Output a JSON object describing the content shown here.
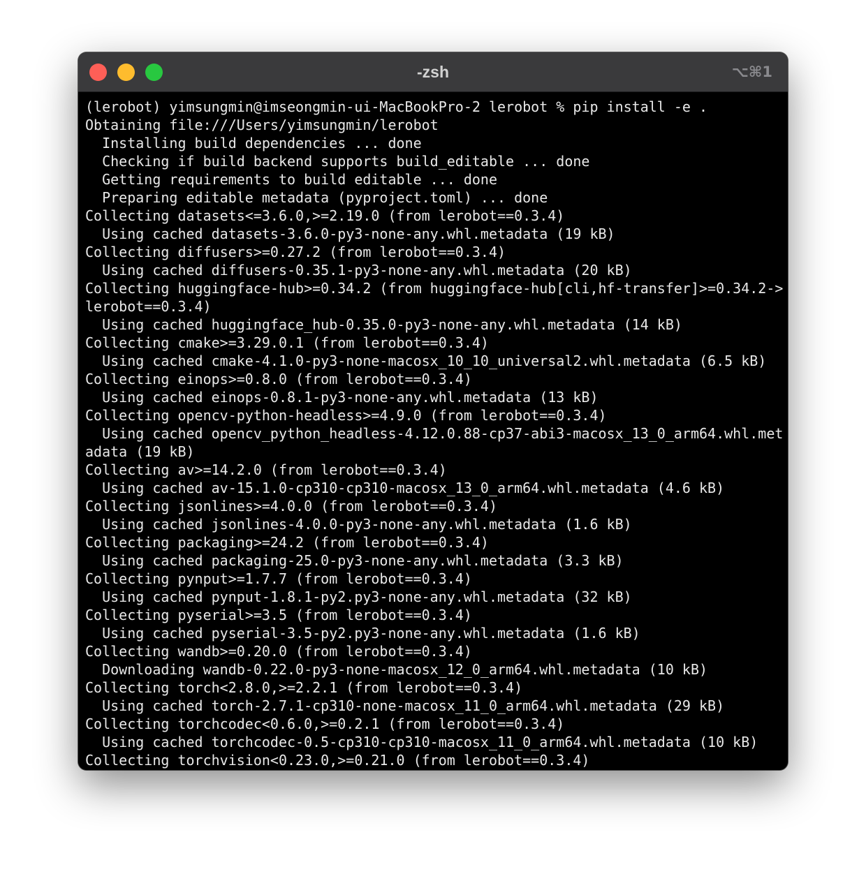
{
  "window": {
    "title": "-zsh",
    "shortcut": "⌥⌘1"
  },
  "terminal": {
    "lines": [
      "(lerobot) yimsungmin@imseongmin-ui-MacBookPro-2 lerobot % pip install -e .",
      "Obtaining file:///Users/yimsungmin/lerobot",
      "  Installing build dependencies ... done",
      "  Checking if build backend supports build_editable ... done",
      "  Getting requirements to build editable ... done",
      "  Preparing editable metadata (pyproject.toml) ... done",
      "Collecting datasets<=3.6.0,>=2.19.0 (from lerobot==0.3.4)",
      "  Using cached datasets-3.6.0-py3-none-any.whl.metadata (19 kB)",
      "Collecting diffusers>=0.27.2 (from lerobot==0.3.4)",
      "  Using cached diffusers-0.35.1-py3-none-any.whl.metadata (20 kB)",
      "Collecting huggingface-hub>=0.34.2 (from huggingface-hub[cli,hf-transfer]>=0.34.2->",
      "lerobot==0.3.4)",
      "  Using cached huggingface_hub-0.35.0-py3-none-any.whl.metadata (14 kB)",
      "Collecting cmake>=3.29.0.1 (from lerobot==0.3.4)",
      "  Using cached cmake-4.1.0-py3-none-macosx_10_10_universal2.whl.metadata (6.5 kB)",
      "Collecting einops>=0.8.0 (from lerobot==0.3.4)",
      "  Using cached einops-0.8.1-py3-none-any.whl.metadata (13 kB)",
      "Collecting opencv-python-headless>=4.9.0 (from lerobot==0.3.4)",
      "  Using cached opencv_python_headless-4.12.0.88-cp37-abi3-macosx_13_0_arm64.whl.met",
      "adata (19 kB)",
      "Collecting av>=14.2.0 (from lerobot==0.3.4)",
      "  Using cached av-15.1.0-cp310-cp310-macosx_13_0_arm64.whl.metadata (4.6 kB)",
      "Collecting jsonlines>=4.0.0 (from lerobot==0.3.4)",
      "  Using cached jsonlines-4.0.0-py3-none-any.whl.metadata (1.6 kB)",
      "Collecting packaging>=24.2 (from lerobot==0.3.4)",
      "  Using cached packaging-25.0-py3-none-any.whl.metadata (3.3 kB)",
      "Collecting pynput>=1.7.7 (from lerobot==0.3.4)",
      "  Using cached pynput-1.8.1-py2.py3-none-any.whl.metadata (32 kB)",
      "Collecting pyserial>=3.5 (from lerobot==0.3.4)",
      "  Using cached pyserial-3.5-py2.py3-none-any.whl.metadata (1.6 kB)",
      "Collecting wandb>=0.20.0 (from lerobot==0.3.4)",
      "  Downloading wandb-0.22.0-py3-none-macosx_12_0_arm64.whl.metadata (10 kB)",
      "Collecting torch<2.8.0,>=2.2.1 (from lerobot==0.3.4)",
      "  Using cached torch-2.7.1-cp310-none-macosx_11_0_arm64.whl.metadata (29 kB)",
      "Collecting torchcodec<0.6.0,>=0.2.1 (from lerobot==0.3.4)",
      "  Using cached torchcodec-0.5-cp310-cp310-macosx_11_0_arm64.whl.metadata (10 kB)",
      "Collecting torchvision<0.23.0,>=0.21.0 (from lerobot==0.3.4)"
    ]
  }
}
